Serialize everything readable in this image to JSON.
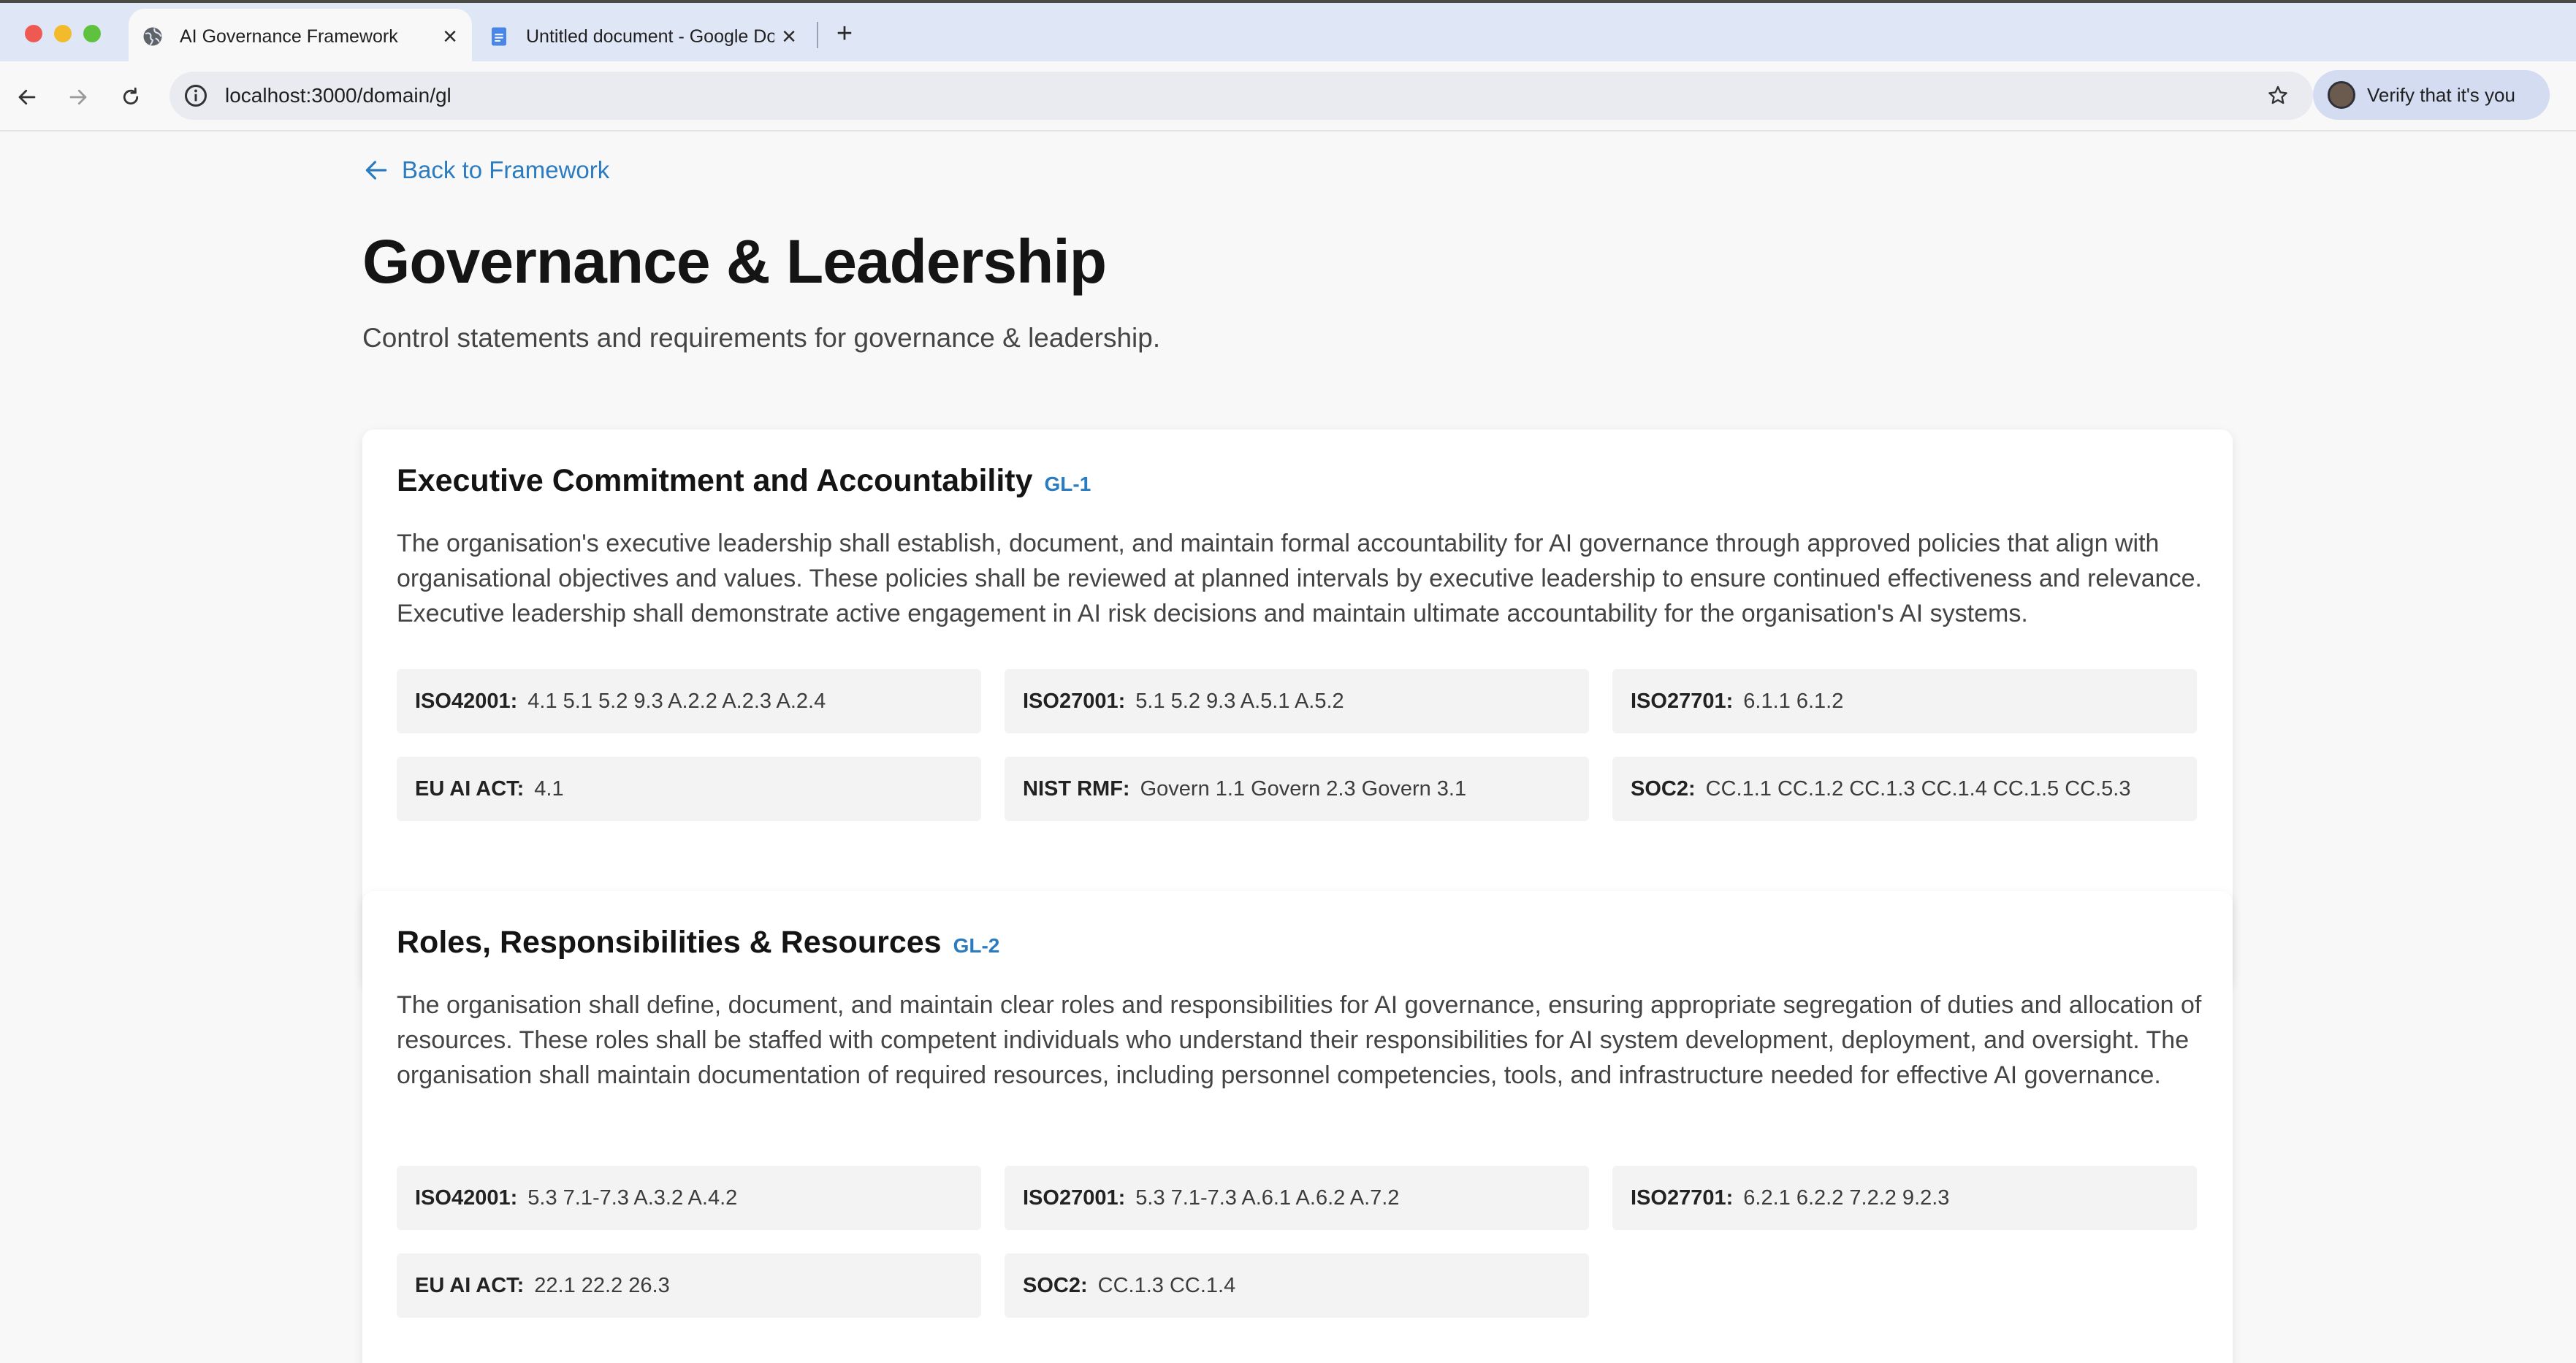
{
  "browser": {
    "tabs": [
      {
        "title": "AI Governance Framework",
        "active": true,
        "icon": "globe-icon"
      },
      {
        "title": "Untitled document - Google Docs",
        "active": false,
        "icon": "google-docs-icon"
      }
    ],
    "url": "localhost:3000/domain/gl",
    "profile_button": "Verify that it's you"
  },
  "page": {
    "back_link": "Back to Framework",
    "title": "Governance & Leadership",
    "subtitle": "Control statements and requirements for governance & leadership."
  },
  "controls": [
    {
      "title": "Executive Commitment and Accountability",
      "id": "GL-1",
      "description": "The organisation's executive leadership shall establish, document, and maintain formal accountability for AI governance through approved policies that align with organisational objectives and values. These policies shall be reviewed at planned intervals by executive leadership to ensure continued effectiveness and relevance. Executive leadership shall demonstrate active engagement in AI risk decisions and maintain ultimate accountability for the organisation's AI systems.",
      "mappings": [
        {
          "standard": "ISO42001:",
          "refs": "4.1 5.1 5.2 9.3 A.2.2 A.2.3 A.2.4"
        },
        {
          "standard": "ISO27001:",
          "refs": "5.1 5.2 9.3 A.5.1 A.5.2"
        },
        {
          "standard": "ISO27701:",
          "refs": "6.1.1 6.1.2"
        },
        {
          "standard": "EU AI ACT:",
          "refs": "4.1"
        },
        {
          "standard": "NIST RMF:",
          "refs": "Govern 1.1 Govern 2.3 Govern 3.1"
        },
        {
          "standard": "SOC2:",
          "refs": "CC.1.1 CC.1.2 CC.1.3 CC.1.4 CC.1.5 CC.5.3"
        }
      ]
    },
    {
      "title": "Roles, Responsibilities & Resources",
      "id": "GL-2",
      "description": "The organisation shall define, document, and maintain clear roles and responsibilities for AI governance, ensuring appropriate segregation of duties and allocation of resources. These roles shall be staffed with competent individuals who understand their responsibilities for AI system development, deployment, and oversight. The organisation shall maintain documentation of required resources, including personnel competencies, tools, and infrastructure needed for effective AI governance.",
      "mappings": [
        {
          "standard": "ISO42001:",
          "refs": "5.3 7.1-7.3 A.3.2 A.4.2"
        },
        {
          "standard": "ISO27001:",
          "refs": "5.3 7.1-7.3 A.6.1 A.6.2 A.7.2"
        },
        {
          "standard": "ISO27701:",
          "refs": "6.2.1 6.2.2 7.2.2 9.2.3"
        },
        {
          "standard": "EU AI ACT:",
          "refs": "22.1 22.2 26.3"
        },
        {
          "standard": "SOC2:",
          "refs": "CC.1.3 CC.1.4"
        }
      ]
    }
  ]
}
